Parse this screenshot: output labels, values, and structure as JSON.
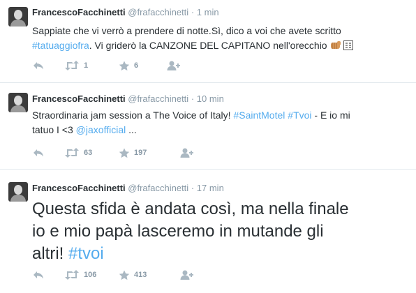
{
  "tweets": [
    {
      "name": "FrancescoFacchinetti",
      "handle": "@frafacchinetti",
      "separator": "·",
      "time": "1 min",
      "text_line1": "Sappiate che vi verrò a prendere di notte.Sì, dico a voi che avete scritto",
      "hashtag": "#tatuaggiofra",
      "text_line2": ". Vi griderò la CANZONE DEL CAPITANO nell'orecchio",
      "retweets": "1",
      "favorites": "6"
    },
    {
      "name": "FrancescoFacchinetti",
      "handle": "@frafacchinetti",
      "separator": "·",
      "time": "10 min",
      "text_a": "Straordinaria jam session a The Voice of Italy! ",
      "hashtag1": "#SaintMotel",
      "space": " ",
      "hashtag2": "#Tvoi",
      "text_b": " - E io mi",
      "text_c": "tatuo  I <3 ",
      "mention": "@jaxofficial",
      "text_d": " ...",
      "retweets": "63",
      "favorites": "197"
    },
    {
      "name": "FrancescoFacchinetti",
      "handle": "@frafacchinetti",
      "separator": "·",
      "time": "17 min",
      "text_line1": "Questa sfida è andata così, ma nella finale",
      "text_line2": "io e mio papà lasceremo in mutande gli",
      "text_line3": "altri! ",
      "hashtag": "#tvoi",
      "retweets": "106",
      "favorites": "413"
    }
  ],
  "icons": [
    "reply-icon",
    "retweet-icon",
    "favorite-icon",
    "follow-icon",
    "fist-emoji-icon",
    "sos-emoji-icon"
  ],
  "colors": {
    "link": "#55acee",
    "meta": "#8899a6",
    "text": "#292f33",
    "divider": "#e1e8ed"
  }
}
